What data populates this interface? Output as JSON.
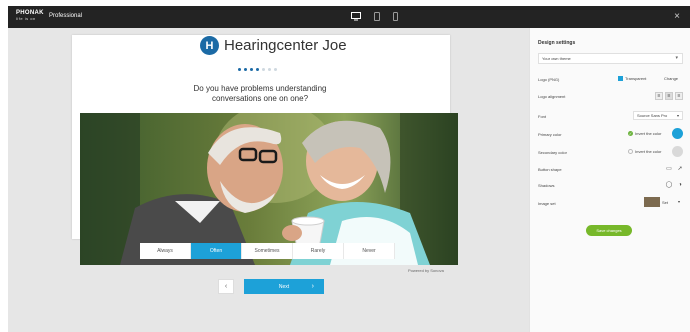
{
  "topbar": {
    "logo_text": "PHONAK",
    "logo_sub": "life is on",
    "product": "Professional",
    "icons": [
      "desktop-icon",
      "tablet-icon",
      "phone-icon"
    ],
    "close_glyph": "×"
  },
  "preview": {
    "brand_name": "Hearingcenter Joe",
    "brand_logo_letter": "H",
    "progress": {
      "current": 4,
      "total": 7
    },
    "question": "Do you have problems understanding conversations one on one?",
    "options": [
      "Always",
      "Often",
      "Sometimes",
      "Rarely",
      "Never"
    ],
    "selected_option": "Often",
    "powered_by": "Powered by Sonova",
    "back_glyph": "‹",
    "next_label": "Next",
    "next_glyph": "›"
  },
  "panel": {
    "title": "Design settings",
    "theme_select": "Your own theme",
    "logo_label": "Logo (PNG)",
    "logo_option": "Transparent",
    "logo_change": "Change",
    "logo_alignment_label": "Logo alignment",
    "font_label": "Font",
    "font_value": "Source Sans Pro",
    "primary_color_label": "Primary color",
    "primary_color_option": "Invert the color",
    "primary_color": "#1da1d8",
    "secondary_color_label": "Secondary color",
    "secondary_color_option": "Invert the color",
    "secondary_color": "#d9d9d9",
    "button_shape_label": "Button shape",
    "shadows_label": "Shadows",
    "image_set_label": "Image set",
    "image_set_value": "Set",
    "save_label": "Save changes"
  },
  "colors": {
    "accent": "#1da1d8",
    "save": "#77b82a",
    "topbar": "#232323",
    "brand": "#1b6aa5"
  }
}
